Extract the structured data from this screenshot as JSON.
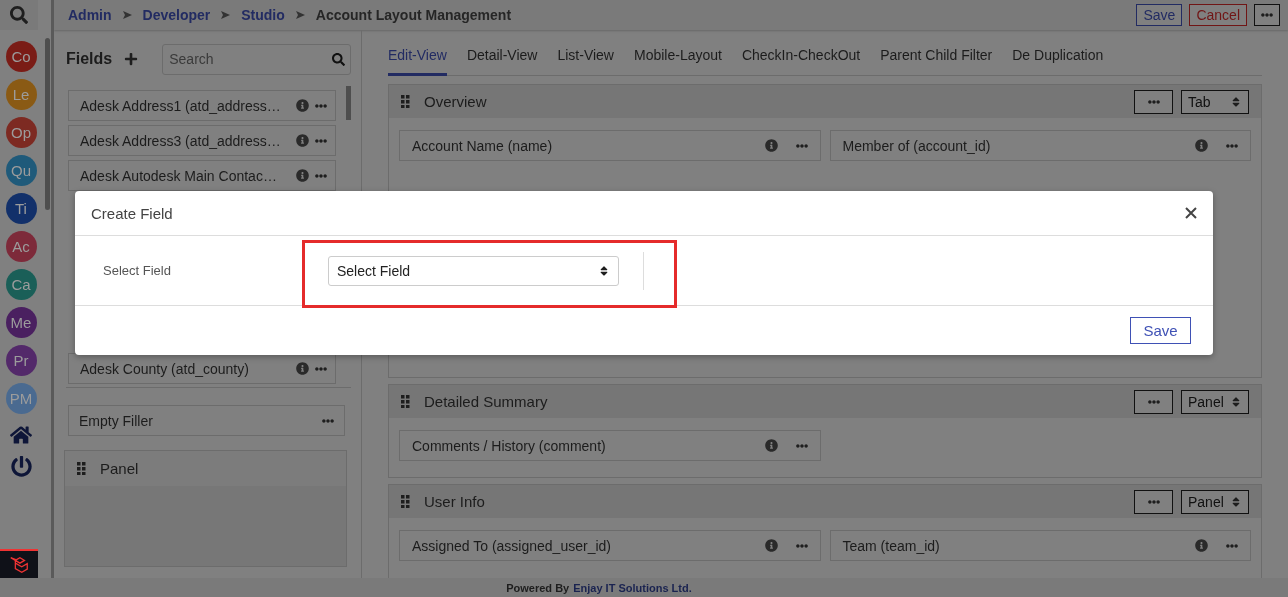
{
  "breadcrumb": [
    {
      "label": "Admin",
      "link": true
    },
    {
      "label": "Developer",
      "link": true
    },
    {
      "label": "Studio",
      "link": true
    },
    {
      "label": "Account Layout Management",
      "link": false
    }
  ],
  "header_buttons": [
    {
      "kind": "save",
      "label": "Save"
    },
    {
      "kind": "cancel",
      "label": "Cancel"
    },
    {
      "kind": "more"
    }
  ],
  "rail": [
    {
      "label": "Co",
      "color": "#7a1c16"
    },
    {
      "label": "Le",
      "color": "#8a5a14"
    },
    {
      "label": "Op",
      "color": "#7d2a22"
    },
    {
      "label": "Qu",
      "color": "#1f5a7a"
    },
    {
      "label": "Ti",
      "color": "#12306a"
    },
    {
      "label": "Ac",
      "color": "#7d2a3a"
    },
    {
      "label": "Ca",
      "color": "#1a5f58"
    },
    {
      "label": "Me",
      "color": "#4a2060"
    },
    {
      "label": "Pr",
      "color": "#53296a"
    },
    {
      "label": "PM",
      "color": "#4a6a90"
    }
  ],
  "fields_panel": {
    "title": "Fields",
    "search": {
      "placeholder": "Search"
    },
    "items": [
      "Adesk Address1 (atd_address…",
      "Adesk Address3 (atd_address…",
      "Adesk Autodesk Main Contac…",
      "Adesk County (atd_county)"
    ],
    "filler": "Empty Filler",
    "panel": "Panel"
  },
  "tabs": [
    {
      "label": "Edit-View",
      "selected": true
    },
    {
      "label": "Detail-View",
      "selected": false
    },
    {
      "label": "List-View",
      "selected": false
    },
    {
      "label": "Mobile-Layout",
      "selected": false
    },
    {
      "label": "CheckIn-CheckOut",
      "selected": false
    },
    {
      "label": "Parent Child Filter",
      "selected": false
    },
    {
      "label": "De Duplication",
      "selected": false
    }
  ],
  "sections": [
    {
      "title": "Overview",
      "type": "Tab",
      "rows": [
        [
          "Account Name (name)",
          "Member of (account_id)"
        ]
      ]
    },
    {
      "title": "Detailed Summary",
      "type": "Panel",
      "rows": [
        [
          "Comments / History (comment)"
        ]
      ]
    },
    {
      "title": "User Info",
      "type": "Panel",
      "rows": [
        [
          "Assigned To (assigned_user_id)",
          "Team (team_id)"
        ]
      ]
    }
  ],
  "modal": {
    "title": "Create Field",
    "label": "Select Field",
    "select": {
      "value": "Select Field"
    },
    "save": "Save"
  },
  "footer": {
    "prefix": "Powered By",
    "company": "Enjay IT Solutions Ltd."
  }
}
